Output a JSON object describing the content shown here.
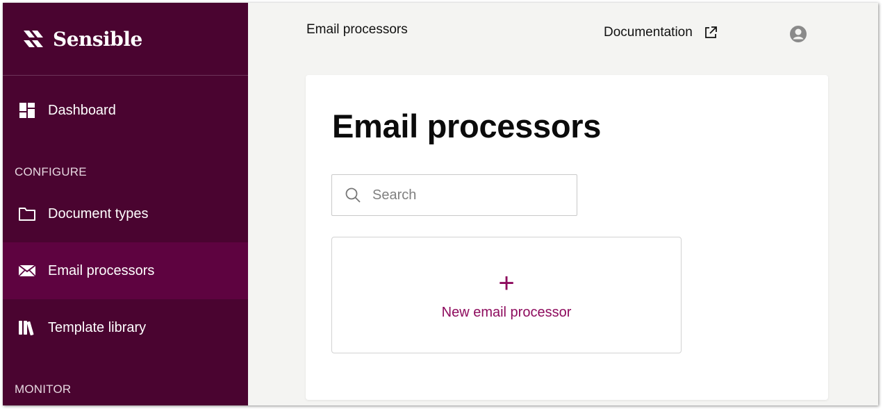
{
  "app": {
    "brand": "Sensible"
  },
  "colors": {
    "sidebar_bg": "#4a0430",
    "sidebar_active_bg": "#5e0340",
    "accent": "#8d0b5d",
    "page_bg": "#f4f4f2"
  },
  "sidebar": {
    "items": [
      {
        "label": "Dashboard",
        "icon": "dashboard-icon"
      },
      {
        "label": "Document types",
        "icon": "folder-icon"
      },
      {
        "label": "Email processors",
        "icon": "envelope-icon",
        "active": true
      },
      {
        "label": "Template library",
        "icon": "library-icon"
      }
    ],
    "sections": {
      "configure": "CONFIGURE",
      "monitor": "MONITOR"
    }
  },
  "header": {
    "breadcrumb": "Email processors",
    "docs_label": "Documentation",
    "docs_icon": "external-link-icon",
    "avatar_icon": "user-avatar-icon"
  },
  "main": {
    "title": "Email processors",
    "search": {
      "placeholder": "Search",
      "value": "",
      "icon": "search-icon"
    },
    "new_tile": {
      "symbol": "+",
      "label": "New email processor",
      "icon": "plus-icon"
    }
  }
}
